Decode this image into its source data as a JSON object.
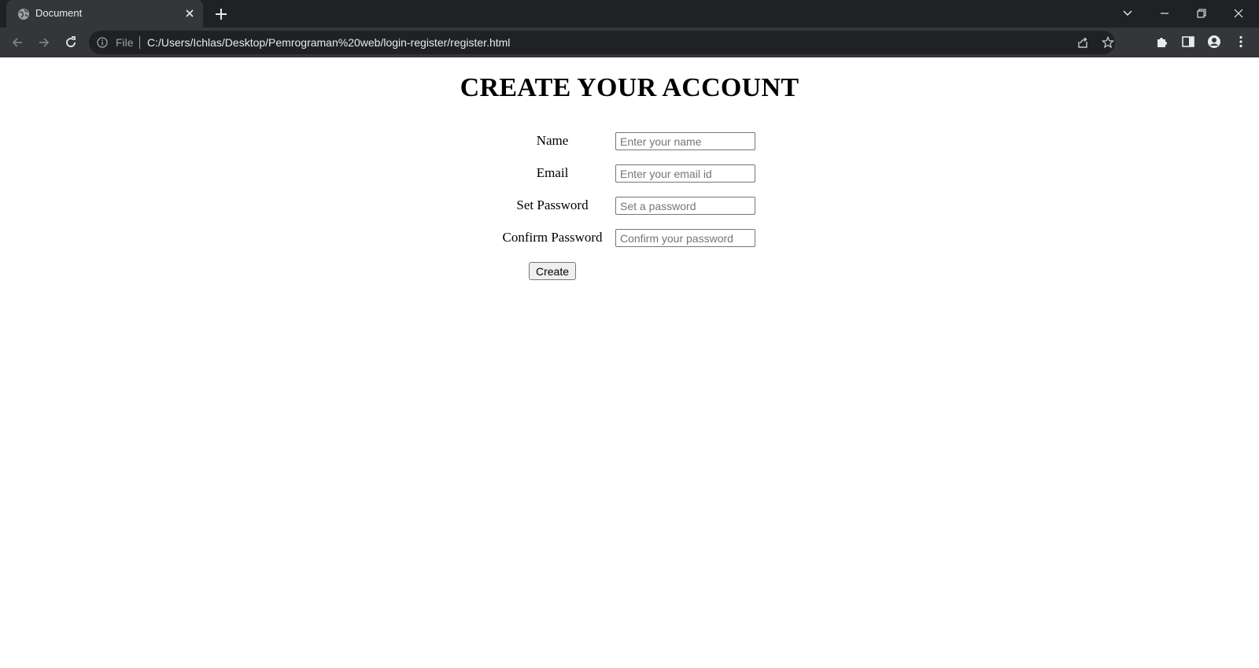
{
  "browser": {
    "tab": {
      "title": "Document"
    },
    "address_bar": {
      "scheme_label": "File",
      "url": "C:/Users/Ichlas/Desktop/Pemrograman%20web/login-register/register.html"
    }
  },
  "page": {
    "heading": "CREATE YOUR ACCOUNT",
    "form": {
      "fields": [
        {
          "label": "Name",
          "placeholder": "Enter your name",
          "value": ""
        },
        {
          "label": "Email",
          "placeholder": "Enter your email id",
          "value": ""
        },
        {
          "label": "Set Password",
          "placeholder": "Set a password",
          "value": ""
        },
        {
          "label": "Confirm Password",
          "placeholder": "Confirm your password",
          "value": ""
        }
      ],
      "submit_label": "Create"
    }
  },
  "colors": {
    "tabbar_bg": "#202124",
    "toolbar_bg": "#35363a",
    "omnibox_bg": "#202124",
    "chrome_text": "#e8eaed",
    "chrome_icon": "#c4c7c5"
  }
}
